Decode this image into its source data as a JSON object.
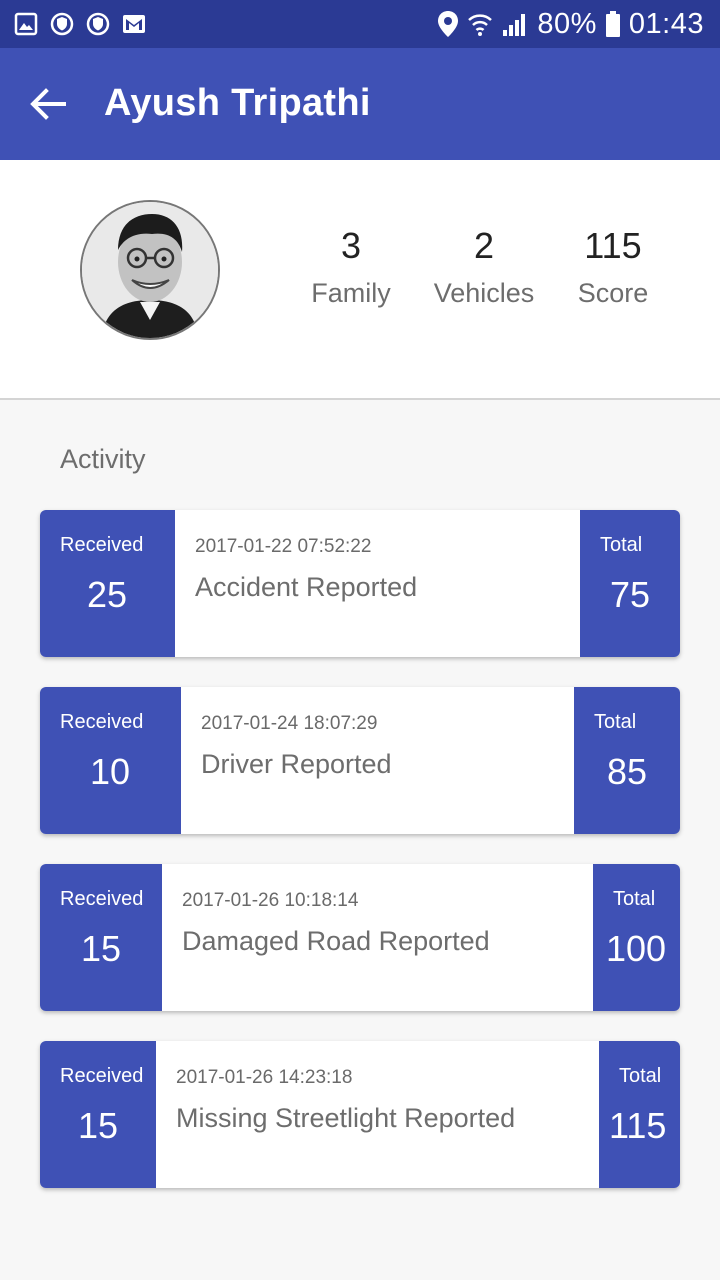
{
  "status_bar": {
    "battery": "80%",
    "time": "01:43",
    "icons_left": [
      "gallery-icon",
      "shield-icon",
      "shield-icon",
      "gmail-icon"
    ],
    "icons_right": [
      "location-icon",
      "wifi-icon",
      "signal-icon",
      "battery-icon"
    ]
  },
  "app_bar": {
    "title": "Ayush Tripathi",
    "back_icon": "arrow-left-icon"
  },
  "profile": {
    "stats": [
      {
        "value": "3",
        "label": "Family"
      },
      {
        "value": "2",
        "label": "Vehicles"
      },
      {
        "value": "115",
        "label": "Score"
      }
    ]
  },
  "activity": {
    "title": "Activity",
    "items": [
      {
        "received_label": "Received",
        "received": "25",
        "datetime": "2017-01-22 07:52:22",
        "description": "Accident Reported",
        "total_label": "Total",
        "total": "75"
      },
      {
        "received_label": "Received",
        "received": "10",
        "datetime": "2017-01-24 18:07:29",
        "description": "Driver Reported",
        "total_label": "Total",
        "total": "85"
      },
      {
        "received_label": "Received",
        "received": "15",
        "datetime": "2017-01-26 10:18:14",
        "description": "Damaged Road Reported",
        "total_label": "Total",
        "total": "100"
      },
      {
        "received_label": "Received",
        "received": "15",
        "datetime": "2017-01-26 14:23:18",
        "description": "Missing Streetlight Reported",
        "total_label": "Total",
        "total": "115"
      }
    ]
  },
  "colors": {
    "primary": "#3f51b5",
    "status_bar": "#2b3a94",
    "background": "#f7f7f7",
    "secondary_text": "#6d6d6d"
  }
}
